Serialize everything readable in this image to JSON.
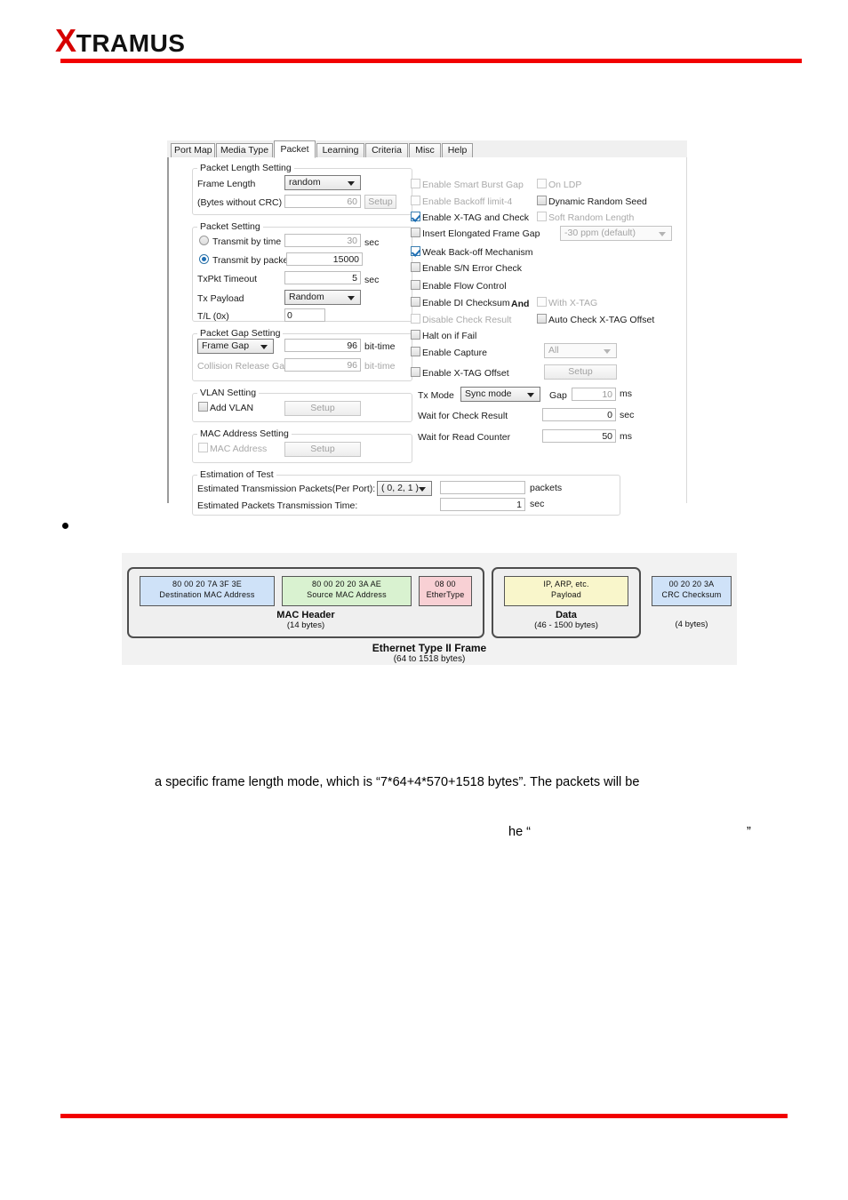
{
  "header": {
    "logo_x": "X",
    "logo_rest": "TRAMUS",
    "accent_color": "#f20000"
  },
  "dialog": {
    "tabs": [
      {
        "label": "Port Map",
        "active": false
      },
      {
        "label": "Media Type",
        "active": false
      },
      {
        "label": "Packet",
        "active": true
      },
      {
        "label": "Learning",
        "active": false
      },
      {
        "label": "Criteria",
        "active": false
      },
      {
        "label": "Misc",
        "active": false
      },
      {
        "label": "Help",
        "active": false
      }
    ],
    "packet_length_setting": {
      "group_label": "Packet Length Setting",
      "frame_length_label": "Frame Length",
      "frame_length_value": "random",
      "bytes_label": "(Bytes without CRC)",
      "bytes_value": "60",
      "setup_label": "Setup"
    },
    "packet_setting": {
      "group_label": "Packet Setting",
      "transmit_by_time_label": "Transmit by time",
      "transmit_by_time_value": "30",
      "transmit_by_time_unit": "sec",
      "transmit_by_packet_label": "Transmit by packet",
      "transmit_by_packet_value": "15000",
      "txpkt_timeout_label": "TxPkt Timeout",
      "txpkt_timeout_value": "5",
      "txpkt_timeout_unit": "sec",
      "tx_payload_label": "Tx Payload",
      "tx_payload_value": "Random",
      "tl_label": "T/L (0x)",
      "tl_value": "0"
    },
    "packet_gap_setting": {
      "group_label": "Packet Gap Setting",
      "frame_gap_value": "Frame Gap",
      "frame_gap_number": "96",
      "frame_gap_unit": "bit-time",
      "collision_release_gap_label": "Collision Release Gap",
      "collision_release_gap_value": "96",
      "collision_release_gap_unit": "bit-time"
    },
    "vlan_setting": {
      "group_label": "VLAN Setting",
      "add_vlan_label": "Add VLAN",
      "setup_label": "Setup"
    },
    "mac_address_setting": {
      "group_label": "MAC Address Setting",
      "mac_address_label": "MAC Address",
      "setup_label": "Setup"
    },
    "estimation_of_test": {
      "group_label": "Estimation of Test",
      "packets_label": "Estimated Transmission Packets(Per Port):",
      "port_combo_value": "( 0, 2, 1 )",
      "packets_value": "",
      "packets_unit": "packets",
      "time_label": "Estimated Packets Transmission Time:",
      "time_value": "1",
      "time_unit": "sec"
    },
    "options_left": [
      {
        "label": "Enable Smart Burst Gap",
        "checked": false,
        "enabled": false
      },
      {
        "label": "Enable Backoff limit-4",
        "checked": false,
        "enabled": false
      },
      {
        "label": "Enable X-TAG and Check",
        "checked": true,
        "enabled": true
      },
      {
        "label": "Insert Elongated Frame Gap",
        "checked": false,
        "enabled": true
      },
      {
        "label": "Weak Back-off Mechanism",
        "checked": true,
        "enabled": true
      },
      {
        "label": "Enable S/N Error Check",
        "checked": false,
        "enabled": true
      },
      {
        "label": "Enable Flow Control",
        "checked": false,
        "enabled": true
      },
      {
        "label": "Enable DI Checksum",
        "checked": false,
        "enabled": true
      },
      {
        "label": "Disable Check Result",
        "checked": false,
        "enabled": false
      },
      {
        "label": "Halt on if Fail",
        "checked": false,
        "enabled": true
      },
      {
        "label": "Enable Capture",
        "checked": false,
        "enabled": true
      },
      {
        "label": "Enable X-TAG Offset",
        "checked": false,
        "enabled": true
      }
    ],
    "options_right": [
      {
        "label": "On LDP",
        "checked": false,
        "enabled": false
      },
      {
        "label": "Dynamic Random Seed",
        "checked": false,
        "enabled": true
      },
      {
        "label": "Soft Random Length",
        "checked": false,
        "enabled": false
      },
      {
        "label": "Auto Check X-TAG Offset",
        "checked": false,
        "enabled": true
      }
    ],
    "and_label": "And",
    "with_xtag_label": "With X-TAG",
    "ppm_combo_value": "-30 ppm (default)",
    "capture_combo_value": "All",
    "xtag_setup_label": "Setup",
    "tx_mode_label": "Tx Mode",
    "tx_mode_value": "Sync mode",
    "gap_label": "Gap",
    "gap_value": "10",
    "gap_unit": "ms",
    "wait_check_label": "Wait for Check Result",
    "wait_check_value": "0",
    "wait_check_unit": "sec",
    "wait_read_label": "Wait for Read Counter",
    "wait_read_value": "50",
    "wait_read_unit": "ms"
  },
  "ethernet_figure": {
    "dest_mac_hex": "80  00  20  7A  3F  3E",
    "dest_mac_label": "Destination MAC Address",
    "src_mac_hex": "80  00  20  20  3A  AE",
    "src_mac_label": "Source MAC Address",
    "ethertype_hex": "08   00",
    "ethertype_label": "EtherType",
    "payload_line1": "IP, ARP, etc.",
    "payload_line2": "Payload",
    "crc_hex": "00  20  20  3A",
    "crc_label": "CRC Checksum",
    "mac_header_caption": "MAC Header",
    "mac_header_bytes": "(14 bytes)",
    "data_caption": "Data",
    "data_bytes": "(46 - 1500 bytes)",
    "crc_bytes": "(4 bytes)",
    "title": "Ethernet Type II Frame",
    "subtitle": "(64 to 1518 bytes)",
    "colors": {
      "dest": "#cfe2f8",
      "src": "#d9f2d0",
      "ethertype": "#f8d0d4",
      "payload": "#f9f6cb",
      "crc": "#cfe2f8"
    }
  },
  "body_text": {
    "line1": "a specific frame length mode, which is “7*64+4*570+1518 bytes”. The packets will be",
    "line2_a": "he “",
    "line2_b": "”"
  }
}
